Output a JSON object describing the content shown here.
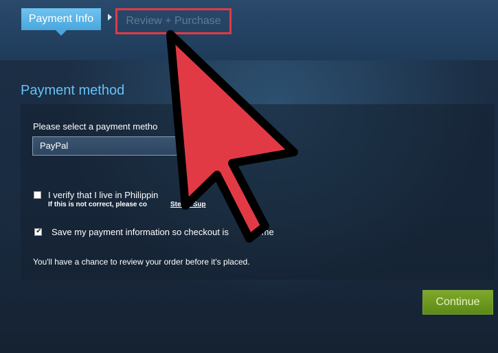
{
  "steps": {
    "active": "Payment Info",
    "next": "Review + Purchase"
  },
  "section": {
    "title": "Payment method"
  },
  "payment": {
    "select_label": "Please select a payment metho",
    "selected_method": "PayPal"
  },
  "verify": {
    "label": "I verify that I live in Philippin",
    "note_prefix": "If this is not correct, please co",
    "note_link": "Steam Sup",
    "checked": false
  },
  "save": {
    "label": "Save my payment information so checkout is",
    "label_end": "t time",
    "checked": true
  },
  "review_note": "You'll have a chance to review your order before it's placed.",
  "buttons": {
    "continue": "Continue"
  },
  "colors": {
    "accent_blue": "#67c1f5",
    "highlight_red": "#e23a45",
    "continue_green": "#6b9a1f",
    "arrow_red": "#e23a45"
  },
  "overlay": {
    "icon": "pointer-arrow-icon"
  }
}
